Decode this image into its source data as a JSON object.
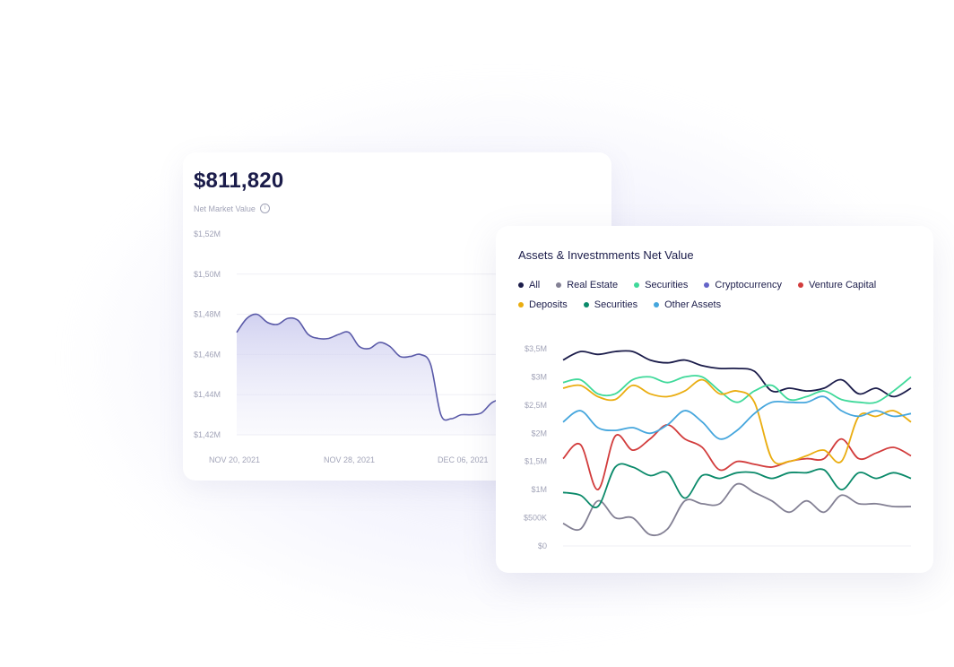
{
  "card1": {
    "value": "$811,820",
    "label": "Net Market Value",
    "info_icon": "info-circle-icon",
    "accent_color": "#5a5aa8",
    "chart_data": {
      "type": "area",
      "y_ticks": [
        "$1,52M",
        "$1,50M",
        "$1,48M",
        "$1,46M",
        "$1,44M",
        "$1,42M"
      ],
      "x_ticks": [
        "NOV 20, 2021",
        "NOV 28, 2021",
        "DEC 06, 2021"
      ],
      "ylim": [
        1.42,
        1.52
      ],
      "y": [
        1.471,
        1.478,
        1.48,
        1.476,
        1.475,
        1.478,
        1.477,
        1.47,
        1.468,
        1.468,
        1.47,
        1.471,
        1.464,
        1.463,
        1.466,
        1.464,
        1.459,
        1.459,
        1.46,
        1.455,
        1.43,
        1.428,
        1.43,
        1.43,
        1.431,
        1.436,
        1.438
      ]
    }
  },
  "card2": {
    "title": "Assets & Investmments Net Value",
    "chart_data": {
      "type": "line",
      "y_ticks": [
        "$3,5M",
        "$3M",
        "$2,5M",
        "$2M",
        "$1,5M",
        "$1M",
        "$500K",
        "$0"
      ],
      "ylim": [
        0,
        3.5
      ],
      "series": [
        {
          "name": "All",
          "color": "#1b1c4a",
          "values": [
            3.3,
            3.45,
            3.4,
            3.45,
            3.45,
            3.3,
            3.25,
            3.3,
            3.2,
            3.15,
            3.15,
            3.1,
            2.75,
            2.8,
            2.75,
            2.8,
            2.95,
            2.7,
            2.8,
            2.65,
            2.8
          ]
        },
        {
          "name": "Real Estate",
          "color": "#838094",
          "values": [
            0.4,
            0.3,
            0.8,
            0.5,
            0.5,
            0.2,
            0.3,
            0.8,
            0.75,
            0.75,
            1.1,
            0.95,
            0.8,
            0.6,
            0.8,
            0.6,
            0.9,
            0.75,
            0.75,
            0.7,
            0.7
          ]
        },
        {
          "name": "Securities",
          "color": "#3fd99a",
          "values": [
            2.9,
            2.95,
            2.7,
            2.7,
            2.95,
            3.0,
            2.9,
            3.0,
            3.0,
            2.75,
            2.55,
            2.75,
            2.85,
            2.6,
            2.65,
            2.75,
            2.6,
            2.55,
            2.55,
            2.75,
            3.0
          ]
        },
        {
          "name": "Cryptocurrency",
          "color": "#6464c8",
          "values": []
        },
        {
          "name": "Venture Capital",
          "color": "#d23c3c",
          "values": [
            1.55,
            1.8,
            1.0,
            1.95,
            1.7,
            1.9,
            2.15,
            1.9,
            1.75,
            1.35,
            1.5,
            1.45,
            1.4,
            1.5,
            1.55,
            1.55,
            1.9,
            1.55,
            1.65,
            1.75,
            1.6
          ]
        },
        {
          "name": "Deposits",
          "color": "#eaad10",
          "values": [
            2.8,
            2.85,
            2.65,
            2.6,
            2.85,
            2.7,
            2.65,
            2.75,
            2.95,
            2.7,
            2.75,
            2.55,
            1.55,
            1.5,
            1.6,
            1.7,
            1.5,
            2.3,
            2.3,
            2.4,
            2.2
          ]
        },
        {
          "name": "Securities",
          "color": "#0b8a6a",
          "values": [
            0.95,
            0.9,
            0.7,
            1.4,
            1.4,
            1.25,
            1.3,
            0.85,
            1.25,
            1.2,
            1.3,
            1.3,
            1.2,
            1.3,
            1.3,
            1.35,
            1.0,
            1.3,
            1.2,
            1.3,
            1.2
          ]
        },
        {
          "name": "Other Assets",
          "color": "#45a6dd",
          "values": [
            2.2,
            2.4,
            2.1,
            2.05,
            2.1,
            2.0,
            2.15,
            2.4,
            2.2,
            1.9,
            2.05,
            2.35,
            2.55,
            2.55,
            2.55,
            2.65,
            2.4,
            2.3,
            2.4,
            2.3,
            2.35
          ]
        }
      ]
    }
  }
}
